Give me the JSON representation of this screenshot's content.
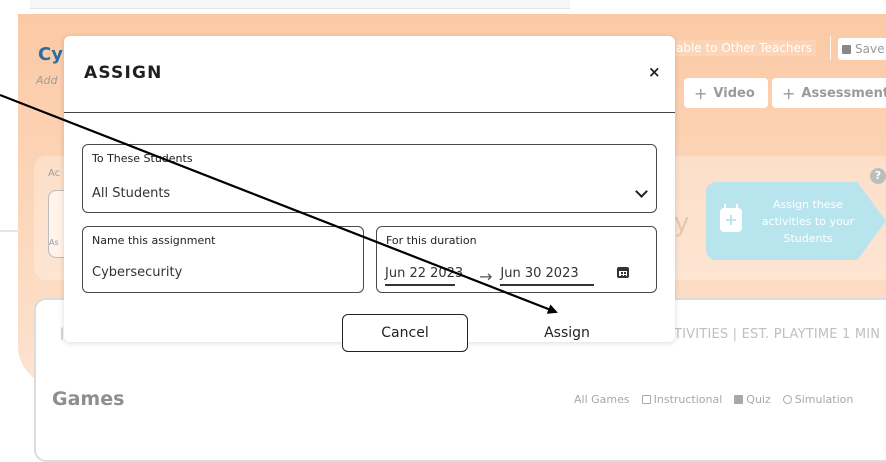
{
  "background": {
    "title": "Cyb",
    "subtitle": "Add",
    "share_label": "able to Other Teachers",
    "save_label": "Save",
    "buttons": {
      "video": "Video",
      "assessment": "Assessment"
    },
    "ac_label": "Ac",
    "as_label": "As",
    "assign_card_text": "Assign these activities to your Students",
    "activities_info": "TIVITIES | EST. PLAYTIME 1 MIN",
    "games_heading": "Games",
    "filters": {
      "all_games": "All Games",
      "instructional": "Instructional",
      "quiz": "Quiz",
      "simulation": "Simulation"
    }
  },
  "modal": {
    "title": "ASSIGN",
    "close_glyph": "×",
    "students_field": {
      "label": "To These Students",
      "value": "All Students"
    },
    "name_field": {
      "label": "Name this assignment",
      "value": "Cybersecurity"
    },
    "duration_field": {
      "label": "For this duration",
      "start": "Jun 22 2023",
      "arrow": "→",
      "end": "Jun 30 2023"
    },
    "cancel_label": "Cancel",
    "assign_label": "Assign"
  },
  "icons": [
    "plus-icon",
    "save-icon",
    "help-icon",
    "calendar-icon",
    "chevron-down-icon",
    "close-icon",
    "instructional-icon",
    "quiz-icon",
    "simulation-icon"
  ],
  "colors": {
    "panel": "#fbc9a5",
    "title_blue": "#2d6d9e",
    "assign_card": "#b8e4ed"
  }
}
